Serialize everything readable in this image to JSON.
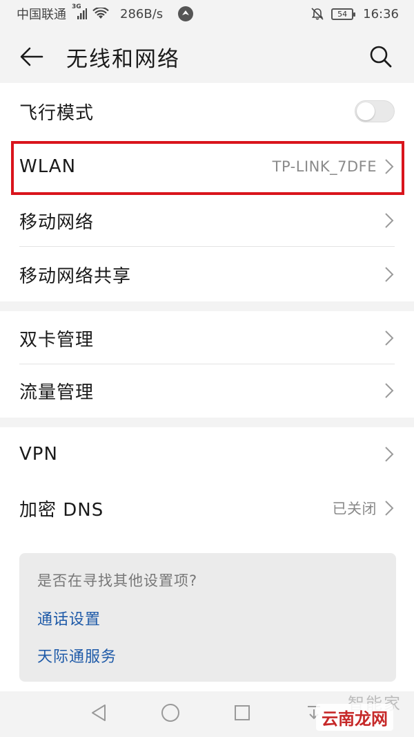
{
  "status_bar": {
    "carrier": "中国联通",
    "network_type": "3G",
    "speed": "286B/s",
    "battery": "54",
    "time": "16:36"
  },
  "header": {
    "title": "无线和网络"
  },
  "sections": [
    {
      "items": [
        {
          "label": "飞行模式",
          "type": "toggle",
          "state": "off"
        },
        {
          "label": "WLAN",
          "value": "TP-LINK_7DFE",
          "type": "link",
          "highlighted": true
        },
        {
          "label": "移动网络",
          "type": "link"
        },
        {
          "label": "移动网络共享",
          "type": "link"
        }
      ]
    },
    {
      "items": [
        {
          "label": "双卡管理",
          "type": "link"
        },
        {
          "label": "流量管理",
          "type": "link"
        }
      ]
    },
    {
      "items": [
        {
          "label": "VPN",
          "type": "link"
        },
        {
          "label": "加密 DNS",
          "value": "已关闭",
          "type": "link"
        }
      ]
    }
  ],
  "suggestions": {
    "title": "是否在寻找其他设置项?",
    "links": [
      "通话设置",
      "天际通服务"
    ]
  },
  "watermark": {
    "main": "云南龙网",
    "faint": "智能家"
  },
  "colors": {
    "highlight": "#d9141c",
    "link": "#1e5aa8",
    "background": "#f3f3f3"
  }
}
